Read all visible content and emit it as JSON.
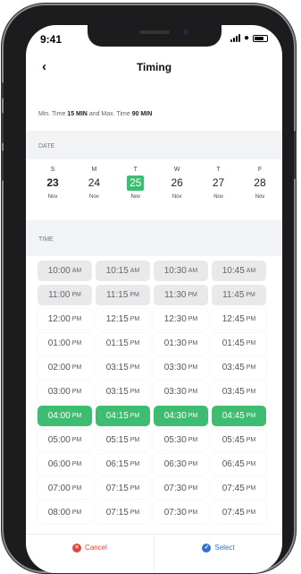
{
  "status": {
    "time": "9:41"
  },
  "header": {
    "title": "Timing"
  },
  "limits": {
    "min_label": "Min. Time",
    "min_value": "15 MIN",
    "connector": "and Max. Time",
    "max_value": "90 MIN"
  },
  "date_section": {
    "label": "DATE"
  },
  "days": [
    {
      "weekday": "S",
      "date": "23",
      "month": "Nov",
      "state": "today"
    },
    {
      "weekday": "M",
      "date": "24",
      "month": "Nov",
      "state": "normal"
    },
    {
      "weekday": "T",
      "date": "25",
      "month": "Nov",
      "state": "selected"
    },
    {
      "weekday": "W",
      "date": "26",
      "month": "Nov",
      "state": "normal"
    },
    {
      "weekday": "T",
      "date": "27",
      "month": "Nov",
      "state": "normal"
    },
    {
      "weekday": "F",
      "date": "28",
      "month": "Nov",
      "state": "normal"
    }
  ],
  "time_section": {
    "label": "TIME"
  },
  "slots": [
    {
      "time": "10:00",
      "ampm": "AM",
      "state": "disabled"
    },
    {
      "time": "10:15",
      "ampm": "AM",
      "state": "disabled"
    },
    {
      "time": "10:30",
      "ampm": "AM",
      "state": "disabled"
    },
    {
      "time": "10:45",
      "ampm": "AM",
      "state": "disabled"
    },
    {
      "time": "11:00",
      "ampm": "PM",
      "state": "disabled"
    },
    {
      "time": "11:15",
      "ampm": "PM",
      "state": "disabled"
    },
    {
      "time": "11:30",
      "ampm": "PM",
      "state": "disabled"
    },
    {
      "time": "11:45",
      "ampm": "PM",
      "state": "disabled"
    },
    {
      "time": "12:00",
      "ampm": "PM",
      "state": "available"
    },
    {
      "time": "12:15",
      "ampm": "PM",
      "state": "available"
    },
    {
      "time": "12:30",
      "ampm": "PM",
      "state": "available"
    },
    {
      "time": "12:45",
      "ampm": "PM",
      "state": "available"
    },
    {
      "time": "01:00",
      "ampm": "PM",
      "state": "available"
    },
    {
      "time": "01:15",
      "ampm": "PM",
      "state": "available"
    },
    {
      "time": "01:30",
      "ampm": "PM",
      "state": "available"
    },
    {
      "time": "01:45",
      "ampm": "PM",
      "state": "available"
    },
    {
      "time": "02:00",
      "ampm": "PM",
      "state": "available"
    },
    {
      "time": "03:15",
      "ampm": "PM",
      "state": "available"
    },
    {
      "time": "03:30",
      "ampm": "PM",
      "state": "available"
    },
    {
      "time": "03:45",
      "ampm": "PM",
      "state": "available"
    },
    {
      "time": "03:00",
      "ampm": "PM",
      "state": "available"
    },
    {
      "time": "03:15",
      "ampm": "PM",
      "state": "available"
    },
    {
      "time": "03:30",
      "ampm": "PM",
      "state": "available"
    },
    {
      "time": "03:45",
      "ampm": "PM",
      "state": "available"
    },
    {
      "time": "04:00",
      "ampm": "PM",
      "state": "selected"
    },
    {
      "time": "04:15",
      "ampm": "PM",
      "state": "selected"
    },
    {
      "time": "04:30",
      "ampm": "PM",
      "state": "selected"
    },
    {
      "time": "04:45",
      "ampm": "PM",
      "state": "selected"
    },
    {
      "time": "05:00",
      "ampm": "PM",
      "state": "available"
    },
    {
      "time": "05:15",
      "ampm": "PM",
      "state": "available"
    },
    {
      "time": "05:30",
      "ampm": "PM",
      "state": "available"
    },
    {
      "time": "05:45",
      "ampm": "PM",
      "state": "available"
    },
    {
      "time": "06:00",
      "ampm": "PM",
      "state": "available"
    },
    {
      "time": "06:15",
      "ampm": "PM",
      "state": "available"
    },
    {
      "time": "06:30",
      "ampm": "PM",
      "state": "available"
    },
    {
      "time": "06:45",
      "ampm": "PM",
      "state": "available"
    },
    {
      "time": "07:00",
      "ampm": "PM",
      "state": "available"
    },
    {
      "time": "07:15",
      "ampm": "PM",
      "state": "available"
    },
    {
      "time": "07:30",
      "ampm": "PM",
      "state": "available"
    },
    {
      "time": "07:45",
      "ampm": "PM",
      "state": "available"
    },
    {
      "time": "08:00",
      "ampm": "PM",
      "state": "available"
    },
    {
      "time": "07:15",
      "ampm": "PM",
      "state": "available"
    },
    {
      "time": "07:30",
      "ampm": "PM",
      "state": "available"
    },
    {
      "time": "07:45",
      "ampm": "PM",
      "state": "available"
    }
  ],
  "footer": {
    "cancel_label": "Cancel",
    "select_label": "Select"
  },
  "colors": {
    "accent_green": "#3ebd72",
    "cancel_red": "#e0463a",
    "select_blue": "#2f6fd6"
  },
  "icons": {
    "back": "chevron-left-icon",
    "cancel": "x-circle-icon",
    "select": "check-circle-icon"
  }
}
